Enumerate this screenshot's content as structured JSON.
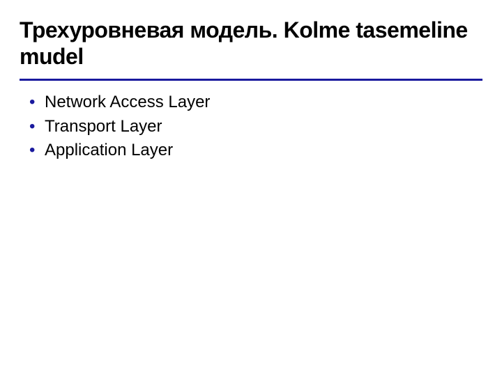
{
  "title": "Трехуровневая модель. Kolme tasemeline mudel",
  "bullets": [
    "Network Access Layer",
    "Transport Layer",
    "Application Layer"
  ]
}
